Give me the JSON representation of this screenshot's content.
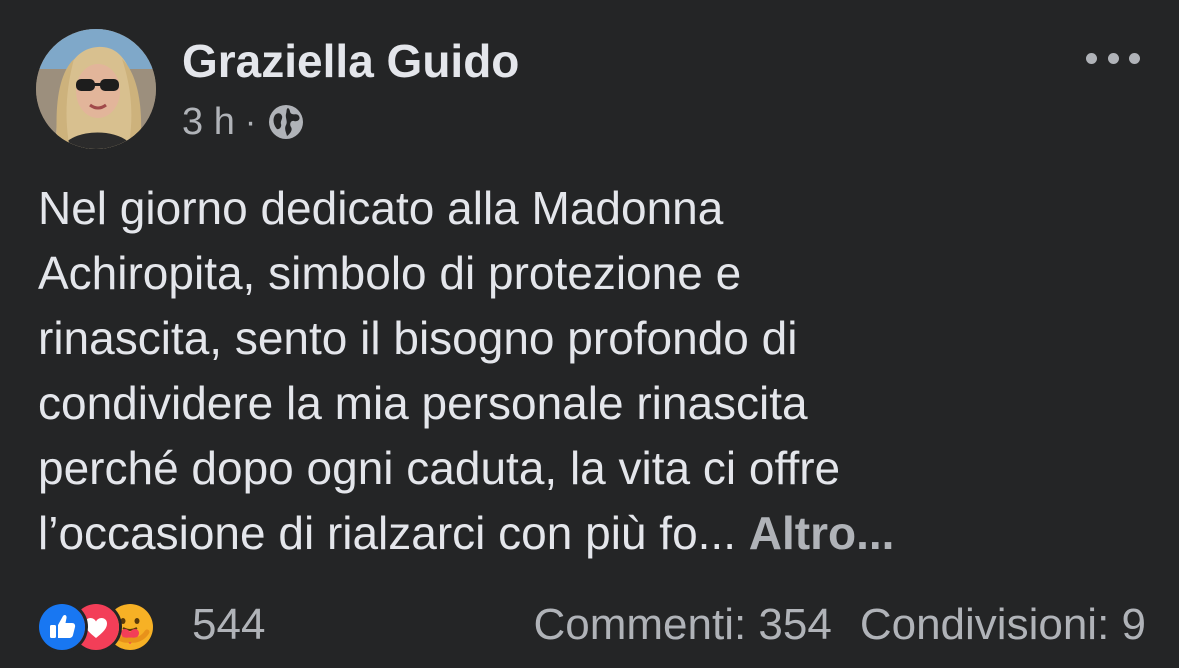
{
  "post": {
    "author": "Graziella Guido",
    "time": "3 h",
    "separator": "·",
    "privacy_icon": "globe-icon",
    "menu_icon": "more-horizontal-icon",
    "text_lines": [
      "Nel giorno dedicato alla Madonna",
      "Achiropita, simbolo di protezione e",
      "rinascita, sento il bisogno profondo di",
      "condividere la mia personale rinascita",
      "perché dopo ogni caduta, la vita ci offre",
      "l’occasione di rialzarci con più fo..."
    ],
    "see_more": "Altro..."
  },
  "footer": {
    "reactions": [
      "like-icon",
      "love-icon",
      "care-icon"
    ],
    "reaction_count": "544",
    "comments": "Commenti: 354",
    "shares": "Condivisioni: 9"
  },
  "colors": {
    "background": "#242526",
    "primary_text": "#e4e6eb",
    "secondary_text": "#b0b3b8",
    "like_blue": "#1877f2",
    "love_red": "#f33e58",
    "care_yellow": "#f7b125"
  }
}
